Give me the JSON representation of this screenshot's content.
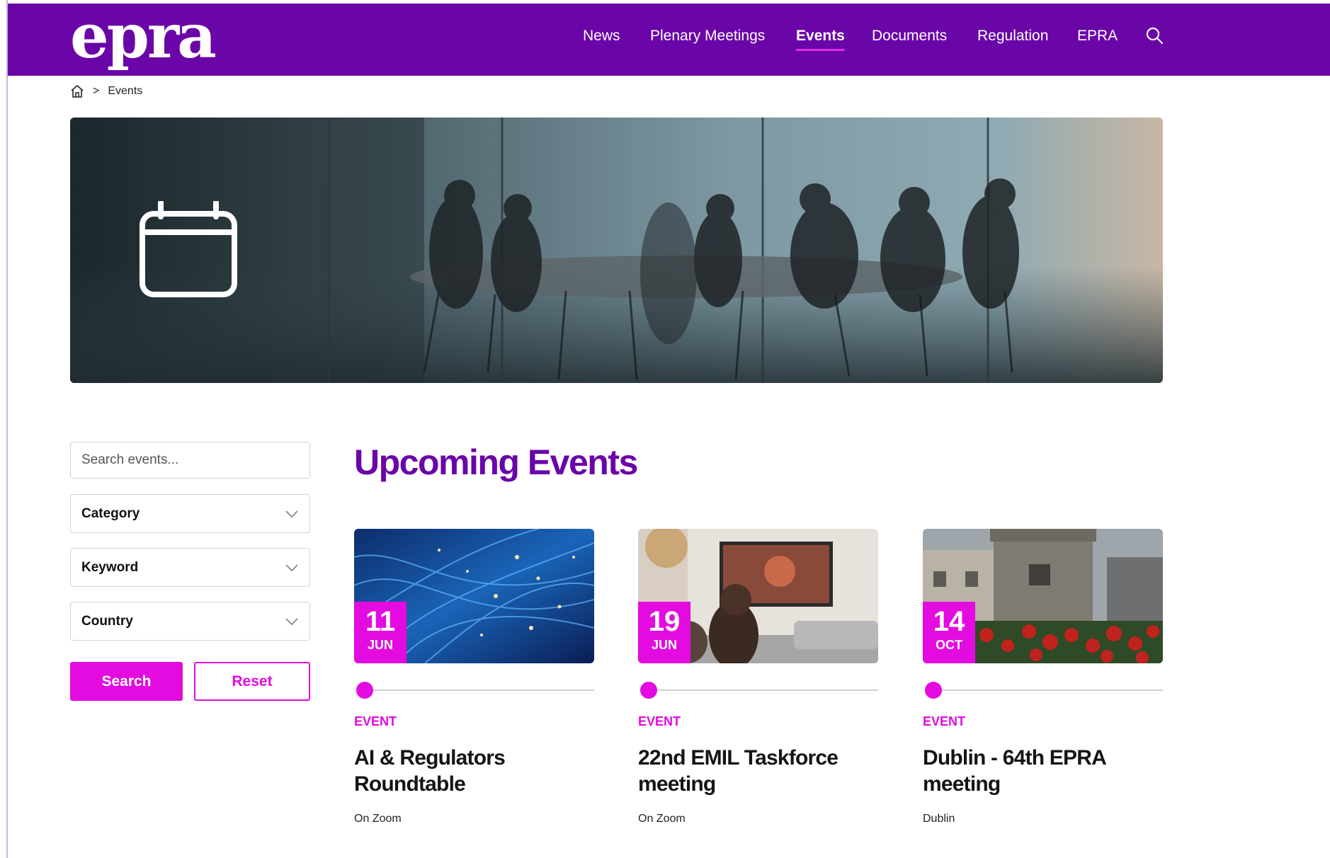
{
  "brand": {
    "logo_text": "epra",
    "primary": "#6a05a8",
    "accent": "#e30be0"
  },
  "nav": {
    "items": [
      {
        "label": "News"
      },
      {
        "label": "Plenary Meetings"
      },
      {
        "label": "Events",
        "active": true
      },
      {
        "label": "Documents"
      },
      {
        "label": "Regulation"
      },
      {
        "label": "EPRA"
      }
    ],
    "search_icon": "search-icon"
  },
  "breadcrumb": {
    "home_icon": "home-icon",
    "separator": ">",
    "current": "Events"
  },
  "hero": {
    "icon": "calendar-icon"
  },
  "filters": {
    "search_placeholder": "Search events...",
    "category_label": "Category",
    "keyword_label": "Keyword",
    "country_label": "Country",
    "search_button": "Search",
    "reset_button": "Reset"
  },
  "events_section": {
    "title": "Upcoming Events",
    "events": [
      {
        "day": "11",
        "month": "JUN",
        "type": "EVENT",
        "title": "AI & Regulators Roundtable",
        "location": "On Zoom"
      },
      {
        "day": "19",
        "month": "JUN",
        "type": "EVENT",
        "title": "22nd EMIL Taskforce meeting",
        "location": "On Zoom"
      },
      {
        "day": "14",
        "month": "OCT",
        "type": "EVENT",
        "title": "Dublin - 64th EPRA meeting",
        "location": "Dublin"
      }
    ]
  }
}
